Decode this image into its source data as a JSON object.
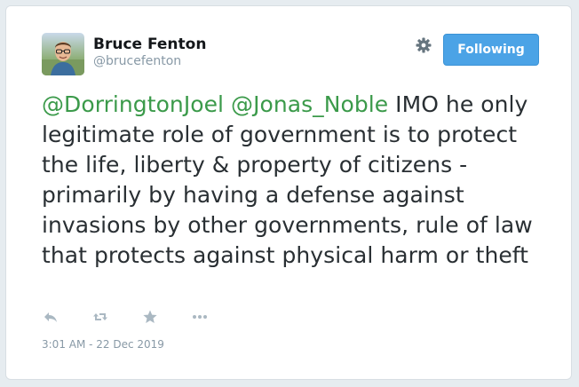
{
  "author": {
    "display_name": "Bruce Fenton",
    "handle": "@brucefenton"
  },
  "header": {
    "settings_icon": "gear-icon",
    "follow_button_label": "Following",
    "follow_button_color": "#4ba3e6"
  },
  "tweet": {
    "mention_1": "@DorringtonJoel",
    "mention_2": "@Jonas_Noble",
    "body_line_1": " IMO he",
    "body_rest": "only legitimate role of government is to protect the life, liberty & property of citizens - primarily by having a defense against invasions by other governments, rule of law that protects against physical harm or theft",
    "mention_color": "#3b9a4a"
  },
  "actions": [
    {
      "icon": "reply-icon"
    },
    {
      "icon": "retweet-icon"
    },
    {
      "icon": "star-icon"
    },
    {
      "icon": "more-icon"
    }
  ],
  "meta": {
    "timestamp": "3:01 AM - 22 Dec 2019"
  }
}
